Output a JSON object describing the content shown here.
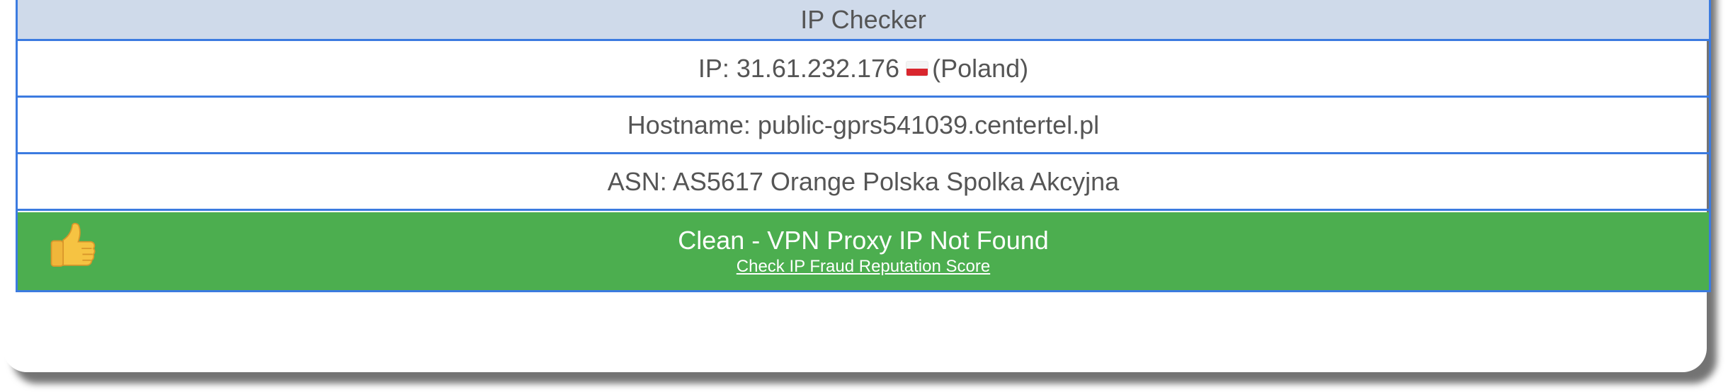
{
  "header": {
    "title": "IP Checker"
  },
  "ip_row": {
    "label": "IP: 31.61.232.176",
    "country": "(Poland)",
    "flag_icon": "poland-flag-icon"
  },
  "hostname_row": {
    "text": "Hostname: public-gprs541039.centertel.pl"
  },
  "asn_row": {
    "text": "ASN: AS5617 Orange Polska Spolka Akcyjna"
  },
  "status": {
    "title": "Clean - VPN Proxy IP Not Found",
    "link": "Check IP Fraud Reputation Score",
    "icon": "thumbs-up-icon",
    "color": "#4cae4f"
  },
  "colors": {
    "header_bg": "#cfdaea",
    "border": "#3c7be0"
  }
}
